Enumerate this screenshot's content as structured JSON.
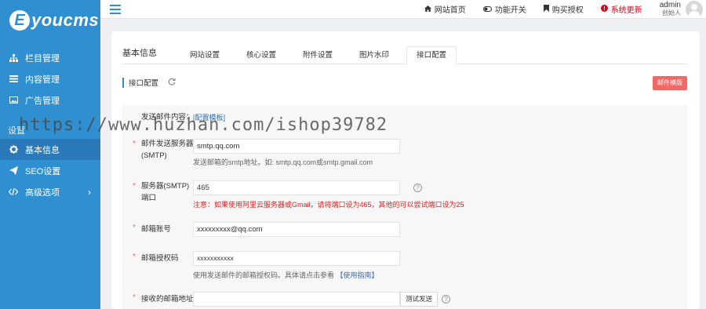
{
  "brand": {
    "logo_letter": "E",
    "logo_text": "youcms"
  },
  "sidebar": {
    "items": [
      {
        "label": "栏目管理",
        "icon": "sitemap-icon"
      },
      {
        "label": "内容管理",
        "icon": "list-icon"
      },
      {
        "label": "广告管理",
        "icon": "image-icon"
      }
    ],
    "section": "设置",
    "settings_items": [
      {
        "label": "基本信息",
        "icon": "gear-icon",
        "active": true
      },
      {
        "label": "SEO设置",
        "icon": "paper-plane-icon"
      },
      {
        "label": "高级选项",
        "icon": "code-icon"
      }
    ]
  },
  "topbar": {
    "links": [
      {
        "label": "网站首页",
        "icon": "home-icon"
      },
      {
        "label": "功能开关",
        "icon": "toggle-icon"
      },
      {
        "label": "购买授权",
        "icon": "bookmark-icon"
      },
      {
        "label": "系统更新",
        "icon": "alert-icon"
      }
    ],
    "user": {
      "name": "admin",
      "role": "创始人"
    }
  },
  "tabs": {
    "title": "基本信息",
    "items": [
      "网站设置",
      "核心设置",
      "附件设置",
      "图片水印",
      "接口配置"
    ],
    "active": "接口配置"
  },
  "subbar": {
    "title": "接口配置",
    "button": "邮件模版"
  },
  "form": {
    "email_content_label": "发送邮件内容：",
    "email_content_link": "[配置模板]",
    "smtp_server": {
      "label_line1": "邮件发送服务器",
      "label_line2": "(SMTP)",
      "value": "smtp.qq.com",
      "hint": "发送邮箱的smtp地址。如: smtp.qq.com或smtp.gmail.com"
    },
    "smtp_port": {
      "label_line1": "服务器(SMTP)",
      "label_line2": "端口",
      "value": "465",
      "hint": "注意：如果使用阿里云服务器或Gmail，请将端口设为465，其他的可以尝试端口设为25"
    },
    "email_account": {
      "label": "邮箱账号",
      "value": "xxxxxxxxx@qq.com"
    },
    "email_auth": {
      "label": "邮箱授权码",
      "value": "xxxxxxxxxxx",
      "hint_prefix": "使用发送邮件的邮箱授权码。具体请点击参看",
      "hint_link": "【使用指南】"
    },
    "receive_email": {
      "label": "接收的邮箱地址",
      "value": "",
      "test_button": "测试发送"
    }
  },
  "watermark": "https://www.huzhan.com/ishop39782",
  "colors": {
    "sidebar": "#2f8fd0",
    "accent_button": "#f16866",
    "warning": "#e02020"
  }
}
